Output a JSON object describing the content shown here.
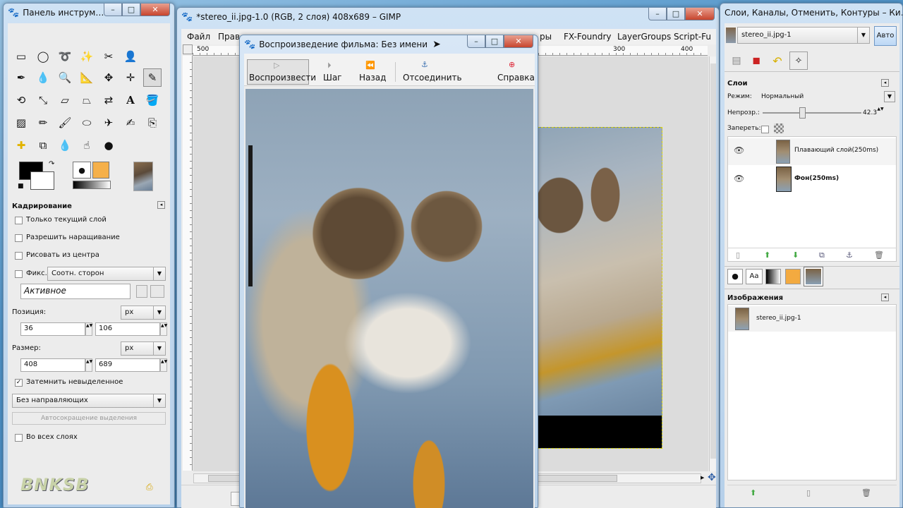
{
  "toolbox": {
    "title": "Панель инструм…",
    "tool_options_title": "Кадрирование",
    "current_layer_only": "Только текущий слой",
    "allow_growing": "Разрешить наращивание",
    "expand_from_center": "Рисовать из центра",
    "fixed_label": "Фикс.:",
    "fixed_value": "Соотн. сторон",
    "active_field": "Активное",
    "position_label": "Позиция:",
    "position_unit": "px",
    "position_x": "36",
    "position_y": "106",
    "size_label": "Размер:",
    "size_unit": "px",
    "size_w": "408",
    "size_h": "689",
    "highlight_label": "Затемнить невыделенное",
    "guides_value": "Без направляющих",
    "autoshrink_label": "Автосокращение выделения",
    "all_layers_label": "Во всех слоях",
    "watermark": "BNKSB",
    "colors": {
      "fg": "#000000",
      "bg": "#ffffff"
    }
  },
  "image_window": {
    "title": "*stereo_ii.jpg-1.0 (RGB, 2 слоя) 408x689 – GIMP",
    "menu": [
      "Файл",
      "Прав",
      "ры",
      "FX-Foundry",
      "LayerGroups",
      "Script-Fu"
    ],
    "ruler_ticks": [
      "500",
      "300",
      "400"
    ]
  },
  "playback": {
    "title": "Воспроизведение фильма: Без имени",
    "buttons": [
      {
        "label": "Воспроизвести",
        "icon": "play-icon"
      },
      {
        "label": "Шаг",
        "icon": "step-icon"
      },
      {
        "label": "Назад",
        "icon": "rewind-icon"
      },
      {
        "label": "Отсоединить",
        "icon": "detach-icon"
      },
      {
        "label": "Справка",
        "icon": "help-icon"
      }
    ]
  },
  "layers_panel": {
    "title": "Слои, Каналы, Отменить, Контуры – Ки…",
    "image_selector": "stereo_ii.jpg-1",
    "auto_button": "Авто",
    "section_title": "Слои",
    "mode_label": "Режим:",
    "mode_value": "Нормальный",
    "opacity_label": "Непрозр.:",
    "opacity_value": "42.3",
    "opacity_level": 0.42,
    "lock_label": "Запереть:",
    "layers": [
      {
        "name": "Плавающий слой(250ms)",
        "visible": true,
        "bold": false
      },
      {
        "name": "Фон(250ms)",
        "visible": true,
        "bold": true
      }
    ],
    "images_title": "Изображения",
    "images": [
      {
        "name": "stereo_ii.jpg-1"
      }
    ],
    "brushes_text_icon": "Aa"
  }
}
